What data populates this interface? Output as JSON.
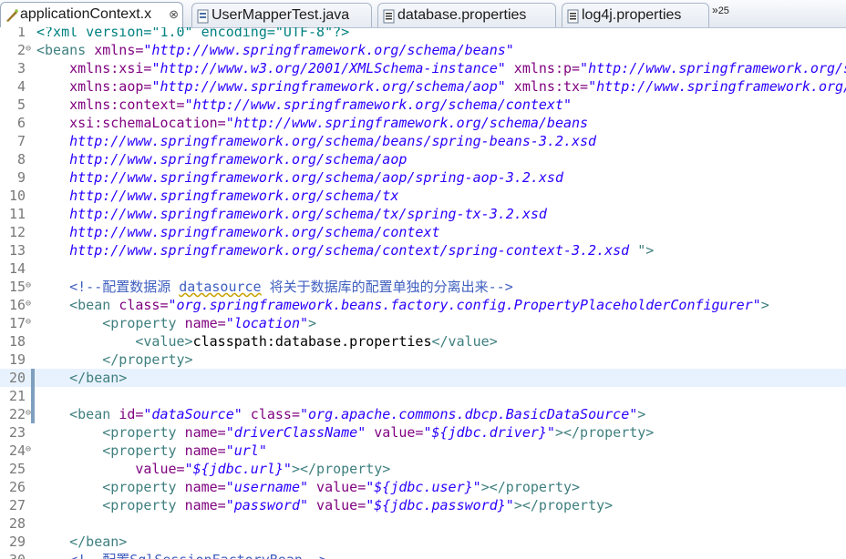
{
  "tabs": [
    {
      "label": "applicationContext.x",
      "icon": "xml-file-icon",
      "active": true,
      "close": "⊗"
    },
    {
      "label": "UserMapperTest.java",
      "icon": "java-file-icon",
      "active": false
    },
    {
      "label": "database.properties",
      "icon": "properties-file-icon",
      "active": false
    },
    {
      "label": "log4j.properties",
      "icon": "properties-file-icon",
      "active": false
    }
  ],
  "overflow": {
    "chevron": "»",
    "count": "25"
  },
  "gutter": {
    "current_line": 20
  },
  "lines": [
    {
      "n": "1",
      "fold": "",
      "tok": [
        [
          "p",
          "<?xml version=\"1.0\" encoding=\"UTF-8\"?>"
        ]
      ]
    },
    {
      "n": "2",
      "fold": "⊖",
      "tok": [
        [
          "t",
          "<beans "
        ],
        [
          "a",
          "xmlns="
        ],
        [
          "v",
          "\"http://www.springframework.org/schema/beans\""
        ]
      ]
    },
    {
      "n": "3",
      "fold": "",
      "tok": [
        [
          "a",
          "    xmlns:xsi="
        ],
        [
          "v",
          "\"http://www.w3.org/2001/XMLSchema-instance\""
        ],
        [
          "a",
          " xmlns:p="
        ],
        [
          "v",
          "\"http://www.springframework.org/schema/p\""
        ]
      ]
    },
    {
      "n": "4",
      "fold": "",
      "tok": [
        [
          "a",
          "    xmlns:aop="
        ],
        [
          "v",
          "\"http://www.springframework.org/schema/aop\""
        ],
        [
          "a",
          " xmlns:tx="
        ],
        [
          "v",
          "\"http://www.springframework.org/schema/tx\""
        ]
      ]
    },
    {
      "n": "5",
      "fold": "",
      "tok": [
        [
          "a",
          "    xmlns:context="
        ],
        [
          "v",
          "\"http://www.springframework.org/schema/context\""
        ]
      ]
    },
    {
      "n": "6",
      "fold": "",
      "tok": [
        [
          "a",
          "    xsi:schemaLocation="
        ],
        [
          "v",
          "\"http://www.springframework.org/schema/beans"
        ]
      ]
    },
    {
      "n": "7",
      "fold": "",
      "tok": [
        [
          "v",
          "    http://www.springframework.org/schema/beans/spring-beans-3.2.xsd"
        ]
      ]
    },
    {
      "n": "8",
      "fold": "",
      "tok": [
        [
          "v",
          "    http://www.springframework.org/schema/aop"
        ]
      ]
    },
    {
      "n": "9",
      "fold": "",
      "tok": [
        [
          "v",
          "    http://www.springframework.org/schema/aop/spring-aop-3.2.xsd"
        ]
      ]
    },
    {
      "n": "10",
      "fold": "",
      "tok": [
        [
          "v",
          "    http://www.springframework.org/schema/tx"
        ]
      ]
    },
    {
      "n": "11",
      "fold": "",
      "tok": [
        [
          "v",
          "    http://www.springframework.org/schema/tx/spring-tx-3.2.xsd"
        ]
      ]
    },
    {
      "n": "12",
      "fold": "",
      "tok": [
        [
          "v",
          "    http://www.springframework.org/schema/context"
        ]
      ]
    },
    {
      "n": "13",
      "fold": "",
      "tok": [
        [
          "v",
          "    http://www.springframework.org/schema/context/spring-context-3.2.xsd "
        ],
        [
          "t",
          "\">"
        ]
      ]
    },
    {
      "n": "14",
      "fold": "",
      "tok": []
    },
    {
      "n": "15",
      "fold": "⊖",
      "tok": [
        [
          "c",
          "    <!--配置数据源 "
        ],
        [
          "csq",
          "datasource"
        ],
        [
          "c",
          " 将关于数据库的配置单独的分离出来-->"
        ]
      ]
    },
    {
      "n": "16",
      "fold": "⊖",
      "tok": [
        [
          "t",
          "    <bean "
        ],
        [
          "a",
          "class="
        ],
        [
          "v",
          "\"org.springframework.beans.factory.config.PropertyPlaceholderConfigurer\""
        ],
        [
          "t",
          ">"
        ]
      ]
    },
    {
      "n": "17",
      "fold": "⊖",
      "tok": [
        [
          "t",
          "        <property "
        ],
        [
          "a",
          "name="
        ],
        [
          "v",
          "\"location\""
        ],
        [
          "t",
          ">"
        ]
      ]
    },
    {
      "n": "18",
      "fold": "",
      "tok": [
        [
          "t",
          "            <value>"
        ],
        [
          "x",
          "classpath:database.properties"
        ],
        [
          "t",
          "</value>"
        ]
      ]
    },
    {
      "n": "19",
      "fold": "",
      "tok": [
        [
          "t",
          "        </property>"
        ]
      ]
    },
    {
      "n": "20",
      "fold": "",
      "tok": [
        [
          "t",
          "    </bean>"
        ]
      ]
    },
    {
      "n": "21",
      "fold": "",
      "tok": []
    },
    {
      "n": "22",
      "fold": "⊖",
      "tok": [
        [
          "t",
          "    <bean "
        ],
        [
          "a",
          "id="
        ],
        [
          "v",
          "\"dataSource\""
        ],
        [
          "a",
          " class="
        ],
        [
          "v",
          "\"org.apache.commons.dbcp.BasicDataSource\""
        ],
        [
          "t",
          ">"
        ]
      ]
    },
    {
      "n": "23",
      "fold": "",
      "tok": [
        [
          "t",
          "        <property "
        ],
        [
          "a",
          "name="
        ],
        [
          "v",
          "\"driverClassName\""
        ],
        [
          "a",
          " value="
        ],
        [
          "v",
          "\"${jdbc.driver}\""
        ],
        [
          "t",
          "></property>"
        ]
      ]
    },
    {
      "n": "24",
      "fold": "⊖",
      "tok": [
        [
          "t",
          "        <property "
        ],
        [
          "a",
          "name="
        ],
        [
          "v",
          "\"url\""
        ]
      ]
    },
    {
      "n": "25",
      "fold": "",
      "tok": [
        [
          "a",
          "            value="
        ],
        [
          "v",
          "\"${jdbc.url}\""
        ],
        [
          "t",
          "></property>"
        ]
      ]
    },
    {
      "n": "26",
      "fold": "",
      "tok": [
        [
          "t",
          "        <property "
        ],
        [
          "a",
          "name="
        ],
        [
          "v",
          "\"username\""
        ],
        [
          "a",
          " value="
        ],
        [
          "v",
          "\"${jdbc.user}\""
        ],
        [
          "t",
          "></property>"
        ]
      ]
    },
    {
      "n": "27",
      "fold": "",
      "tok": [
        [
          "t",
          "        <property "
        ],
        [
          "a",
          "name="
        ],
        [
          "v",
          "\"password\""
        ],
        [
          "a",
          " value="
        ],
        [
          "v",
          "\"${jdbc.password}\""
        ],
        [
          "t",
          "></property>"
        ]
      ]
    },
    {
      "n": "28",
      "fold": "",
      "tok": []
    },
    {
      "n": "29",
      "fold": "",
      "tok": [
        [
          "t",
          "    </bean>"
        ]
      ]
    },
    {
      "n": "30",
      "fold": "",
      "tok": [
        [
          "c",
          "    <!--配置SqlSessionFactoryBean-->"
        ]
      ]
    }
  ]
}
